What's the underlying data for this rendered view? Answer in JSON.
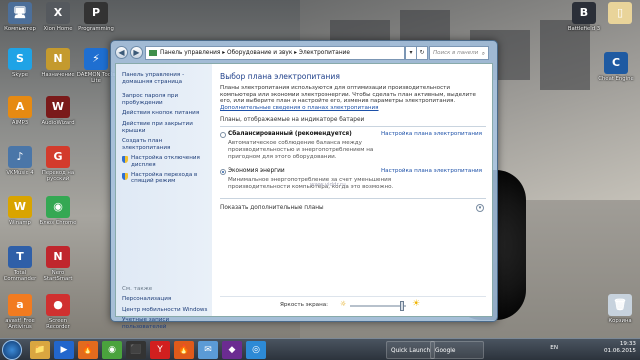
{
  "desktop": {
    "icons": [
      {
        "label": "Компьютер",
        "color": "#4c6f9a",
        "glyph": "🖥"
      },
      {
        "label": "Xion Home",
        "color": "#55595e",
        "glyph": "X"
      },
      {
        "label": "Programming",
        "color": "#333",
        "glyph": "P"
      },
      {
        "label": "Skype",
        "color": "#1fa3e6",
        "glyph": "S"
      },
      {
        "label": "Назначение",
        "color": "#c49a2e",
        "glyph": "N"
      },
      {
        "label": "DAEMON Tools Lite",
        "color": "#1f6fd1",
        "glyph": "⚡"
      },
      {
        "label": "AIMP3",
        "color": "#e68a12",
        "glyph": "A"
      },
      {
        "label": "AudioWizard",
        "color": "#7a1a1a",
        "glyph": "W"
      },
      {
        "label": "VKMusic 4",
        "color": "#4a76a8",
        "glyph": "♪"
      },
      {
        "label": "Перевод на русский",
        "color": "#d33b2c",
        "glyph": "G"
      },
      {
        "label": "Winamp",
        "color": "#d9a400",
        "glyph": "W"
      },
      {
        "label": "Блюз Chrome",
        "color": "#34a853",
        "glyph": "◉"
      },
      {
        "label": "Total Commander",
        "color": "#2f5fa8",
        "glyph": "T"
      },
      {
        "label": "Nero StartSmart",
        "color": "#c0262d",
        "glyph": "N"
      },
      {
        "label": "avast! Free Antivirus",
        "color": "#f27b20",
        "glyph": "a"
      },
      {
        "label": "Screen Recorder",
        "color": "#d03030",
        "glyph": "●"
      },
      {
        "label": "Battlefield 3",
        "color": "#2b2f38",
        "glyph": "B"
      },
      {
        "label": "",
        "color": "#e9d49a",
        "glyph": "▯"
      },
      {
        "label": "Cheat Engine",
        "color": "#1e5aa2",
        "glyph": "C"
      },
      {
        "label": "Корзина",
        "color": "#c7d2dd",
        "glyph": "🗑"
      }
    ]
  },
  "window": {
    "address": "Панель управления ▸ Оборудование и звук ▸ Электропитание",
    "search_placeholder": "Поиск в панели управления",
    "sidebar": {
      "home": "Панель управления - домашняя страница",
      "links": [
        "Запрос пароля при пробуждении",
        "Действия кнопок питания",
        "Действие при закрытии крышки",
        "Создать план электропитания",
        "Настройка отключения дисплея",
        "Настройка перехода в спящий режим"
      ],
      "see_also": "См. также",
      "bottom_links": [
        "Персонализация",
        "Центр мобильности Windows",
        "Учетные записи пользователей"
      ]
    },
    "main": {
      "title": "Выбор плана электропитания",
      "intro": "Планы электропитания используются для оптимизации производительности компьютера или экономии электроэнергии. Чтобы сделать план активным, выделите его, или выберите план и настройте его, изменив параметры электропитания.",
      "intro_link": "Дополнительные сведения о планах электропитания",
      "group_label": "Планы, отображаемые на индикаторе батареи",
      "plans": [
        {
          "name": "Сбалансированный (рекомендуется)",
          "desc": "Автоматическое соблюдение баланса между производительностью и энергопотреблением на пригодном для этого оборудовании.",
          "link": "Настройка плана электропитания",
          "selected": false
        },
        {
          "name": "Экономия энергии",
          "desc": "Минимальное энергопотребление за счет уменьшения производительности компьютера, когда это возможно.",
          "link": "Настройка плана электропитания",
          "selected": true
        }
      ],
      "more_plans": "Показать дополнительные планы",
      "watermark": "www.viddr.ru",
      "brightness_label": "Яркость экрана:"
    }
  },
  "taskbar": {
    "pinned_glyphs": [
      "📁",
      "▶",
      "🔥",
      "◉",
      "⬛",
      "Y",
      "🔥",
      "✉",
      "◆",
      "◎"
    ],
    "pinned_colors": [
      "#d9a640",
      "#2266cc",
      "#e36b1d",
      "#4aa33d",
      "#333",
      "#d21f1f",
      "#e05a1a",
      "#5b9bd6",
      "#6b2c91",
      "#2d8ad6"
    ],
    "quick_launch": "Quick Launch",
    "chrome_task": "Google Chrome",
    "lang": "EN",
    "time": "19:33",
    "date": "01.06.2015"
  }
}
